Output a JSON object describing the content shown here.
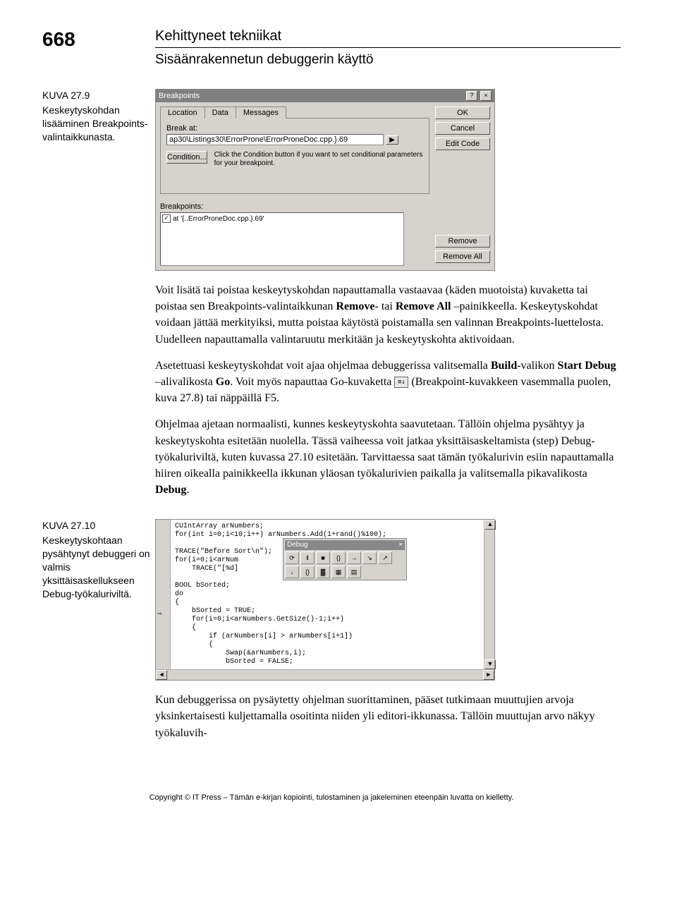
{
  "page_number": "668",
  "section_title": "Kehittyneet tekniikat",
  "subsection_title": "Sisäänrakennetun debuggerin käyttö",
  "figure1": {
    "label": "KUVA 27.9",
    "caption": "Keskeytyskohdan lisääminen Breakpoints-valintaikkunasta."
  },
  "dialog": {
    "title": "Breakpoints",
    "help_btn": "?",
    "close_btn": "×",
    "tabs": {
      "location": "Location",
      "data": "Data",
      "messages": "Messages"
    },
    "ok": "OK",
    "cancel": "Cancel",
    "edit_code": "Edit Code",
    "break_at_label": "Break at:",
    "break_at_value": "ap30\\Listings30\\ErrorProne\\ErrorProneDoc.cpp.}.69",
    "arrow": "▶",
    "condition_btn": "Condition...",
    "hint": "Click the Condition button if you want to set conditional parameters for your breakpoint.",
    "bp_label": "Breakpoints:",
    "bp_item": "at '{..ErrorProneDoc.cpp.}.69'",
    "check": "✓",
    "remove": "Remove",
    "remove_all": "Remove All"
  },
  "para1_a": "Voit lisätä tai poistaa keskeytyskohdan napauttamalla vastaavaa (käden muotoista) kuvaketta tai poistaa sen Breakpoints-valintaikkunan ",
  "para1_b": "Remove",
  "para1_c": "- tai ",
  "para1_d": "Remove All",
  "para1_e": " –painikkeella. Keskeytyskohdat voidaan jättää merkityiksi, mutta poistaa käytöstä poistamalla sen valinnan Breakpoints-luettelosta. Uudelleen napauttamalla valintaruutu merkitään ja keskeytyskohta aktivoidaan.",
  "para2_a": "Asetettuasi keskeytyskohdat voit ajaa ohjelmaa debuggerissa valitsemalla ",
  "para2_b": "Build",
  "para2_c": "-valikon ",
  "para2_d": "Start Debug",
  "para2_e": " –alivalikosta ",
  "para2_f": "Go",
  "para2_g": ". Voit myös napauttaa Go-kuvaketta ",
  "para2_icon": "≡↓",
  "para2_h": " (Breakpoint-kuvakkeen vasemmalla puolen, kuva 27.8) tai näppäillä F5.",
  "para3_a": "Ohjelmaa ajetaan normaalisti, kunnes keskeytyskohta saavutetaan. Tällöin ohjelma pysähtyy ja keskeytyskohta esitetään nuolella. Tässä vaiheessa voit jatkaa yksittäisaskeltamista (step) Debug-työkaluriviltä, kuten kuvassa 27.10 esitetään. Tarvittaessa saat tämän työkalurivin esiin napauttamalla hiiren oikealla painikkeella ikkunan yläosan työkalurivien paikalla ja valitsemalla pikavalikosta ",
  "para3_b": "Debug",
  "para3_c": ".",
  "figure2": {
    "label": "KUVA 27.10",
    "caption": "Keskeytyskohtaan pysähtynyt debuggeri on valmis yksittäisaskellukseen Debug-työkaluriviltä."
  },
  "code": {
    "l1": "CUIntArray arNumbers;",
    "l2": "for(int i=0;i<10;i++) arNumbers.Add(1+rand()%100);",
    "l3": "",
    "l4": "TRACE(\"Before Sort\\n\");",
    "l5": "for(i=0;i<arNum",
    "l6": "    TRACE(\"[%d]",
    "l7": "",
    "l8": "BOOL bSorted;",
    "l9": "do",
    "l10": "{",
    "l11": "    bSorted = TRUE;",
    "l12": "    for(i=0;i<arNumbers.GetSize()-1;i++)",
    "l13": "    {",
    "l14": "        if (arNumbers[i] > arNumbers[i+1])",
    "l15": "        {",
    "l16": "            Swap(&arNumbers,i);",
    "l17": "            bSorted = FALSE;",
    "toolbar_title": "Debug",
    "toolbar_close": "×",
    "icons": [
      "⟳",
      "‖",
      "■",
      "{}",
      "→",
      "↘",
      "↗",
      "↓",
      "{}",
      "▓",
      "▦",
      "▤"
    ],
    "arrow_marker": "⇨"
  },
  "para4": "Kun debuggerissa on pysäytetty ohjelman suorittaminen, pääset tutkimaan muuttujien arvoja yksinkertaisesti kuljettamalla osoitinta niiden yli editori-ikkunassa. Tällöin muuttujan arvo näkyy työkaluvih-",
  "footer": "Copyright © IT Press – Tämän e-kirjan kopiointi, tulostaminen ja jakeleminen eteenpäin luvatta on kielletty."
}
